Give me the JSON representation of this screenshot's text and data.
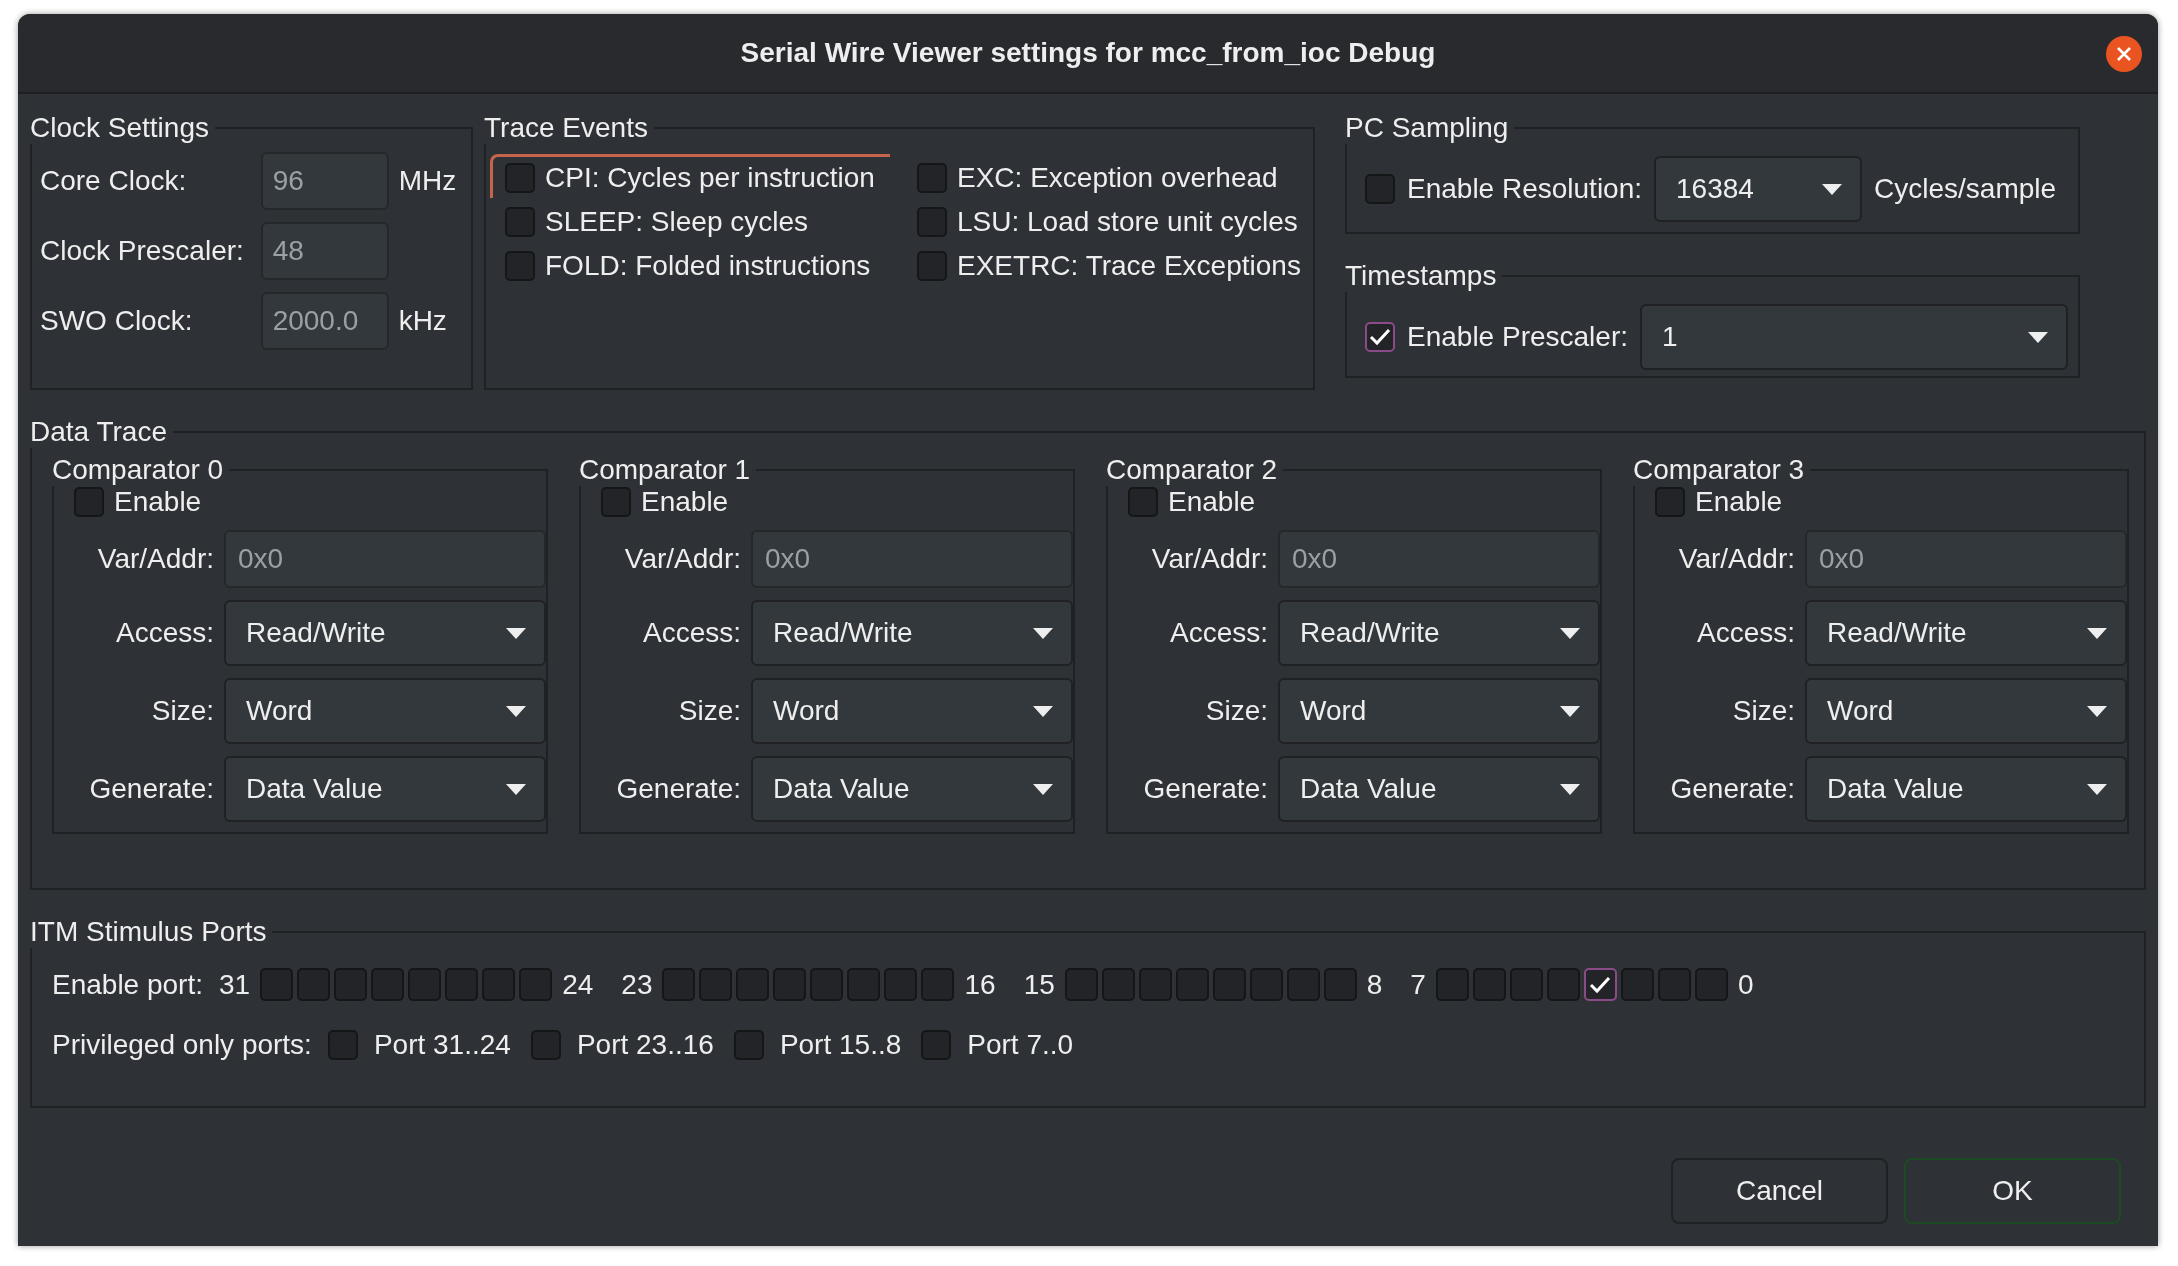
{
  "window": {
    "title": "Serial Wire Viewer settings for mcc_from_ioc Debug"
  },
  "clock_settings": {
    "title": "Clock Settings",
    "fields": [
      {
        "label": "Core Clock:",
        "value": "96",
        "unit": "MHz",
        "disabled": true
      },
      {
        "label": "Clock Prescaler:",
        "value": "48",
        "disabled": true
      },
      {
        "label": "SWO Clock:",
        "value": "2000.0",
        "unit": "kHz",
        "disabled": true
      }
    ]
  },
  "trace_events": {
    "title": "Trace Events",
    "options": [
      {
        "label": "CPI: Cycles per instruction",
        "checked": false,
        "focused": true
      },
      {
        "label": "SLEEP: Sleep cycles",
        "checked": false,
        "focused": false
      },
      {
        "label": "FOLD: Folded instructions",
        "checked": false,
        "focused": false
      },
      {
        "label": "EXC: Exception overhead",
        "checked": false,
        "focused": false
      },
      {
        "label": "LSU: Load store unit cycles",
        "checked": false,
        "focused": false
      },
      {
        "label": "EXETRC: Trace Exceptions",
        "checked": false,
        "focused": false
      }
    ]
  },
  "pc_sampling": {
    "title": "PC Sampling",
    "enable": {
      "label": "Enable Resolution:",
      "checked": false
    },
    "resolution": "16384",
    "unit": "Cycles/sample"
  },
  "timestamps": {
    "title": "Timestamps",
    "enable": {
      "label": "Enable Prescaler:",
      "checked": true
    },
    "prescaler": "1"
  },
  "data_trace": {
    "title": "Data Trace",
    "comparators": [
      {
        "title": "Comparator 0",
        "enable": {
          "label": "Enable",
          "checked": false
        },
        "fields": [
          {
            "kind": "input",
            "label": "Var/Addr:",
            "value": "0x0",
            "disabled": true
          },
          {
            "kind": "dropdown",
            "label": "Access:",
            "value": "Read/Write"
          },
          {
            "kind": "dropdown",
            "label": "Size:",
            "value": "Word"
          },
          {
            "kind": "dropdown",
            "label": "Generate:",
            "value": "Data Value"
          }
        ]
      },
      {
        "title": "Comparator 1",
        "enable": {
          "label": "Enable",
          "checked": false
        },
        "fields": [
          {
            "kind": "input",
            "label": "Var/Addr:",
            "value": "0x0",
            "disabled": true
          },
          {
            "kind": "dropdown",
            "label": "Access:",
            "value": "Read/Write"
          },
          {
            "kind": "dropdown",
            "label": "Size:",
            "value": "Word"
          },
          {
            "kind": "dropdown",
            "label": "Generate:",
            "value": "Data Value"
          }
        ]
      },
      {
        "title": "Comparator 2",
        "enable": {
          "label": "Enable",
          "checked": false
        },
        "fields": [
          {
            "kind": "input",
            "label": "Var/Addr:",
            "value": "0x0",
            "disabled": true
          },
          {
            "kind": "dropdown",
            "label": "Access:",
            "value": "Read/Write"
          },
          {
            "kind": "dropdown",
            "label": "Size:",
            "value": "Word"
          },
          {
            "kind": "dropdown",
            "label": "Generate:",
            "value": "Data Value"
          }
        ]
      },
      {
        "title": "Comparator 3",
        "enable": {
          "label": "Enable",
          "checked": false
        },
        "fields": [
          {
            "kind": "input",
            "label": "Var/Addr:",
            "value": "0x0",
            "disabled": true
          },
          {
            "kind": "dropdown",
            "label": "Access:",
            "value": "Read/Write"
          },
          {
            "kind": "dropdown",
            "label": "Size:",
            "value": "Word"
          },
          {
            "kind": "dropdown",
            "label": "Generate:",
            "value": "Data Value"
          }
        ]
      }
    ]
  },
  "itm_stimulus_ports": {
    "title": "ITM Stimulus Ports",
    "enable_label": "Enable port:",
    "groups": [
      {
        "high": "31",
        "low": "24",
        "ports": [
          {
            "checked": false
          },
          {
            "checked": false
          },
          {
            "checked": false
          },
          {
            "checked": false
          },
          {
            "checked": false
          },
          {
            "checked": false
          },
          {
            "checked": false
          },
          {
            "checked": false
          }
        ]
      },
      {
        "high": "23",
        "low": "16",
        "ports": [
          {
            "checked": false
          },
          {
            "checked": false
          },
          {
            "checked": false
          },
          {
            "checked": false
          },
          {
            "checked": false
          },
          {
            "checked": false
          },
          {
            "checked": false
          },
          {
            "checked": false
          }
        ]
      },
      {
        "high": "15",
        "low": "8",
        "ports": [
          {
            "checked": false
          },
          {
            "checked": false
          },
          {
            "checked": false
          },
          {
            "checked": false
          },
          {
            "checked": false
          },
          {
            "checked": false
          },
          {
            "checked": false
          },
          {
            "checked": false
          }
        ]
      },
      {
        "high": "7",
        "low": "0",
        "ports": [
          {
            "checked": false
          },
          {
            "checked": false
          },
          {
            "checked": false
          },
          {
            "checked": false
          },
          {
            "checked": true
          },
          {
            "checked": false
          },
          {
            "checked": false
          },
          {
            "checked": false
          }
        ]
      }
    ],
    "privileged_label": "Privileged only ports:",
    "privileged": [
      {
        "label": "Port 31..24",
        "checked": false
      },
      {
        "label": "Port 23..16",
        "checked": false
      },
      {
        "label": "Port 15..8",
        "checked": false
      },
      {
        "label": "Port 7..0",
        "checked": false
      }
    ]
  },
  "buttons": [
    {
      "label": "Cancel",
      "default": false
    },
    {
      "label": "OK",
      "default": true
    }
  ]
}
